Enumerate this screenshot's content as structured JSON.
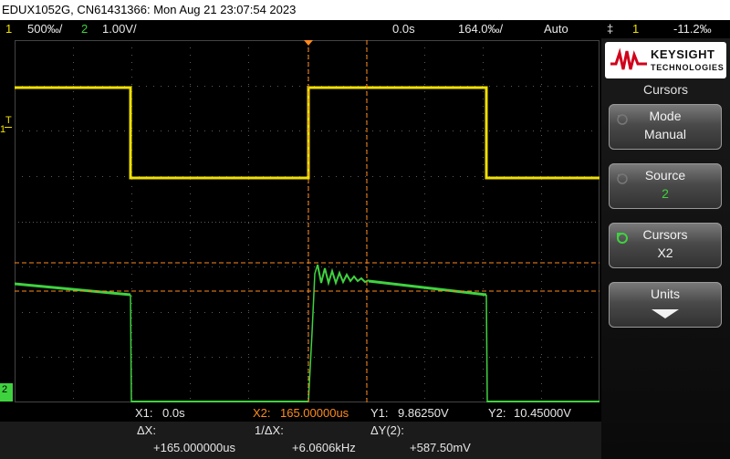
{
  "title": "EDUX1052G, CN61431366: Mon Aug 21 23:07:54 2023",
  "status": {
    "ch1_num": "1",
    "ch1_scale": "500‰/",
    "ch2_num": "2",
    "ch2_scale": "1.00V/",
    "time_delay": "0.0s",
    "time_scale": "164.0‰/",
    "trigger_mode": "Auto",
    "trig_symbol": "‡",
    "trig_source": "1",
    "trig_level": "-11.2‰"
  },
  "markers": {
    "ch1_marker": "1",
    "ch1_t": "T",
    "ch2_marker": "2"
  },
  "sidepanel": {
    "brand": "KEYSIGHT",
    "brand_sub": "TECHNOLOGIES",
    "menu_title": "Cursors",
    "softkeys": [
      {
        "label": "Mode",
        "value": "Manual"
      },
      {
        "label": "Source",
        "value": "2"
      },
      {
        "label": "Cursors",
        "value": "X2"
      },
      {
        "label": "Units",
        "value": ""
      }
    ]
  },
  "cursor_readout": {
    "x1_label": "X1:",
    "x1_value": "0.0s",
    "x2_label": "X2:",
    "x2_value": "165.00000us",
    "y1_label": "Y1:",
    "y1_value": "9.86250V",
    "y2_label": "Y2:",
    "y2_value": "10.45000V",
    "dx_label": "ΔX:",
    "dx_value": "+165.000000us",
    "inv_dx_label": "1/ΔX:",
    "inv_dx_value": "+6.0606kHz",
    "dy_label": "ΔY(2):",
    "dy_value": "+587.50mV"
  },
  "colors": {
    "ch1": "#f0e000",
    "ch2": "#3fd23f",
    "cursor": "#ff8a1d",
    "grid": "#5a5a5a"
  }
}
